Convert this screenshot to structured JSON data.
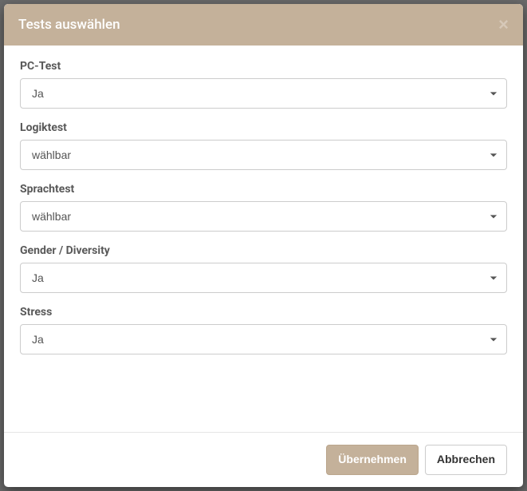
{
  "modal": {
    "title": "Tests auswählen",
    "fields": [
      {
        "label": "PC-Test",
        "value": "Ja"
      },
      {
        "label": "Logiktest",
        "value": "wählbar"
      },
      {
        "label": "Sprachtest",
        "value": "wählbar"
      },
      {
        "label": "Gender / Diversity",
        "value": "Ja"
      },
      {
        "label": "Stress",
        "value": "Ja"
      }
    ],
    "buttons": {
      "submit": "Übernehmen",
      "cancel": "Abbrechen"
    }
  }
}
